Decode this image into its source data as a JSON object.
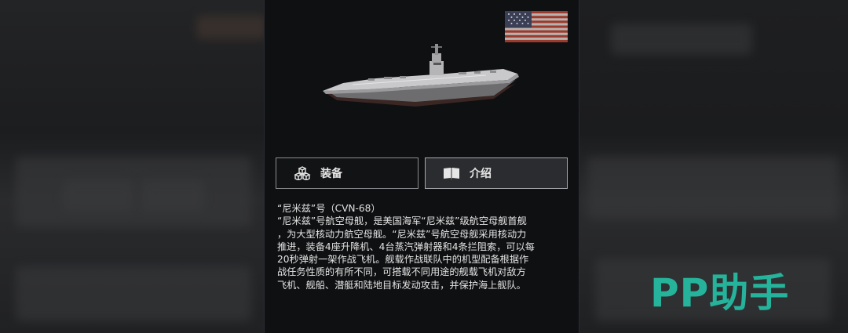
{
  "tabs": {
    "equipment_label": "装备",
    "intro_label": "介绍"
  },
  "description": {
    "title": "“尼米兹”号（CVN-68）",
    "body": "“尼米兹”号航空母舰，是美国海军“尼米兹”级航空母舰首舰\n，为大型核动力航空母舰。“尼米兹”号航空母舰采用核动力\n推进，装备4座升降机、4台蒸汽弹射器和4条拦阻索，可以每\n20秒弹射一架作战飞机。舰载作战联队中的机型配备根据作\n战任务性质的有所不同，可搭载不同用途的舰载飞机对敌方\n飞机、舰船、潜艇和陆地目标发动攻击，并保护海上舰队。"
  },
  "icons": {
    "flag": "usa-flag-icon",
    "equipment": "cubes-icon",
    "intro": "book-icon",
    "ship": "aircraft-carrier-image"
  },
  "watermark": "PP助手",
  "colors": {
    "panel_bg": "#0f1012",
    "button_border": "#8b8d90",
    "active_button_bg": "#2b2c2f",
    "watermark": "#26b39b"
  }
}
